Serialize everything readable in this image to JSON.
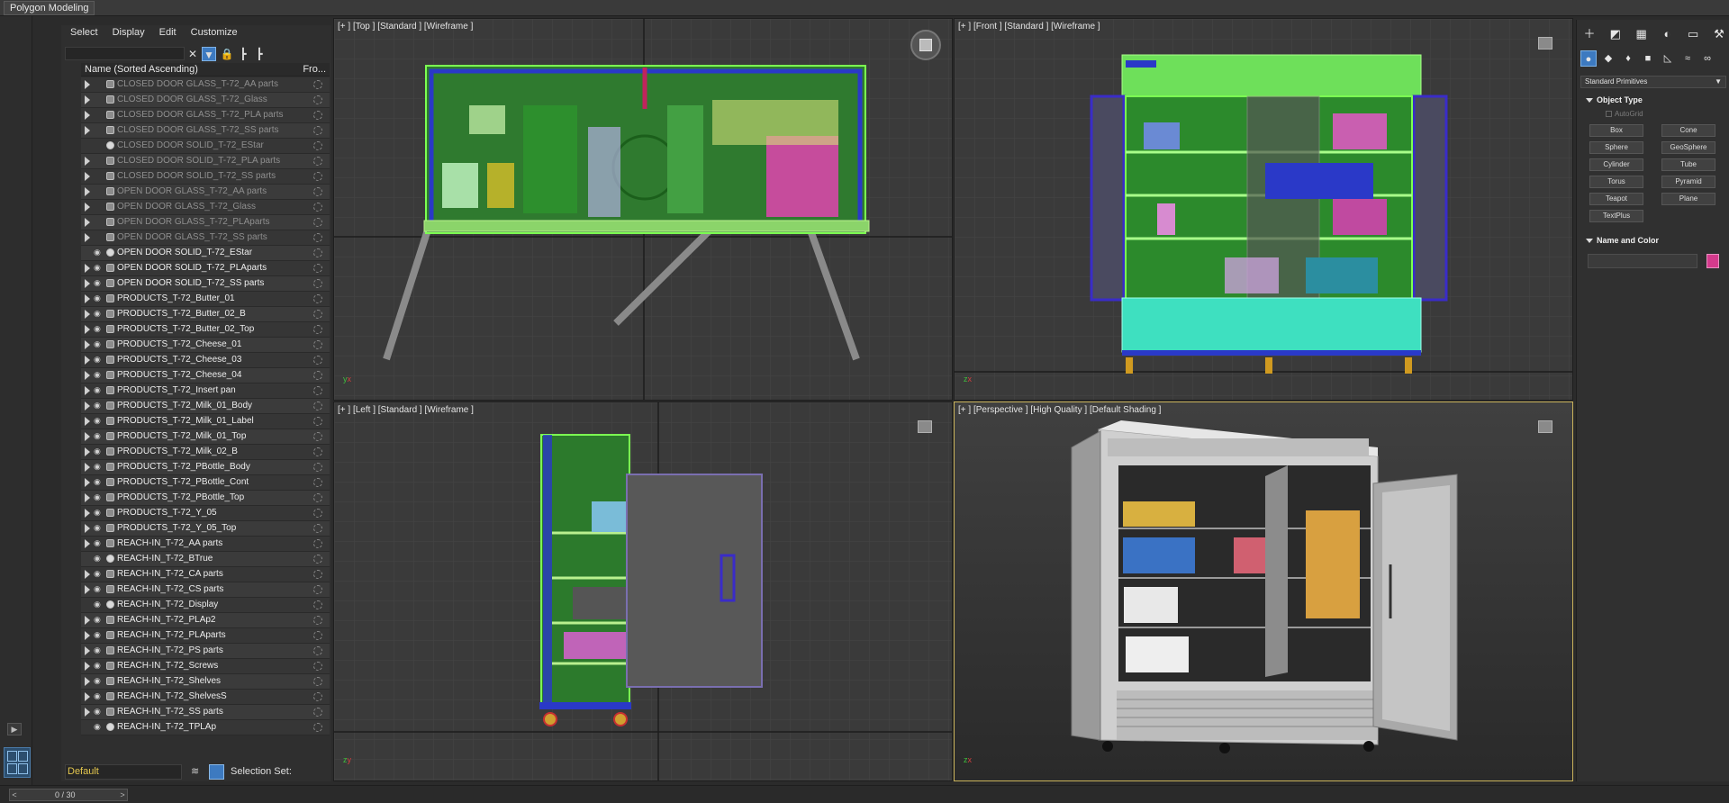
{
  "window": {
    "tab_title": "Polygon Modeling"
  },
  "explorer": {
    "menu": [
      "Select",
      "Display",
      "Edit",
      "Customize"
    ],
    "column_name": "Name (Sorted Ascending)",
    "column_frozen": "Fro...",
    "rows": [
      {
        "name": "CLOSED DOOR GLASS_T-72_AA parts",
        "frozen": true,
        "expand": true,
        "kind": "group"
      },
      {
        "name": "CLOSED DOOR GLASS_T-72_Glass",
        "frozen": true,
        "expand": true,
        "kind": "group"
      },
      {
        "name": "CLOSED DOOR GLASS_T-72_PLA parts",
        "frozen": true,
        "expand": true,
        "kind": "group"
      },
      {
        "name": "CLOSED DOOR GLASS_T-72_SS parts",
        "frozen": true,
        "expand": true,
        "kind": "group"
      },
      {
        "name": "CLOSED DOOR SOLID_T-72_EStar",
        "frozen": true,
        "expand": false,
        "kind": "object"
      },
      {
        "name": "CLOSED DOOR SOLID_T-72_PLA parts",
        "frozen": true,
        "expand": true,
        "kind": "group"
      },
      {
        "name": "CLOSED DOOR SOLID_T-72_SS parts",
        "frozen": true,
        "expand": true,
        "kind": "group"
      },
      {
        "name": "OPEN DOOR GLASS_T-72_AA parts",
        "frozen": true,
        "expand": true,
        "kind": "group"
      },
      {
        "name": "OPEN DOOR GLASS_T-72_Glass",
        "frozen": true,
        "expand": true,
        "kind": "group"
      },
      {
        "name": "OPEN DOOR GLASS_T-72_PLAparts",
        "frozen": true,
        "expand": true,
        "kind": "group"
      },
      {
        "name": "OPEN DOOR GLASS_T-72_SS parts",
        "frozen": true,
        "expand": true,
        "kind": "group"
      },
      {
        "name": "OPEN DOOR SOLID_T-72_EStar",
        "frozen": false,
        "expand": false,
        "kind": "object"
      },
      {
        "name": "OPEN DOOR SOLID_T-72_PLAparts",
        "frozen": false,
        "expand": true,
        "kind": "group"
      },
      {
        "name": "OPEN DOOR SOLID_T-72_SS parts",
        "frozen": false,
        "expand": true,
        "kind": "group"
      },
      {
        "name": "PRODUCTS_T-72_Butter_01",
        "frozen": false,
        "expand": true,
        "kind": "group"
      },
      {
        "name": "PRODUCTS_T-72_Butter_02_B",
        "frozen": false,
        "expand": true,
        "kind": "group"
      },
      {
        "name": "PRODUCTS_T-72_Butter_02_Top",
        "frozen": false,
        "expand": true,
        "kind": "group"
      },
      {
        "name": "PRODUCTS_T-72_Cheese_01",
        "frozen": false,
        "expand": true,
        "kind": "group"
      },
      {
        "name": "PRODUCTS_T-72_Cheese_03",
        "frozen": false,
        "expand": true,
        "kind": "group"
      },
      {
        "name": "PRODUCTS_T-72_Cheese_04",
        "frozen": false,
        "expand": true,
        "kind": "group"
      },
      {
        "name": "PRODUCTS_T-72_Insert pan",
        "frozen": false,
        "expand": true,
        "kind": "group"
      },
      {
        "name": "PRODUCTS_T-72_Milk_01_Body",
        "frozen": false,
        "expand": true,
        "kind": "group"
      },
      {
        "name": "PRODUCTS_T-72_Milk_01_Label",
        "frozen": false,
        "expand": true,
        "kind": "group"
      },
      {
        "name": "PRODUCTS_T-72_Milk_01_Top",
        "frozen": false,
        "expand": true,
        "kind": "group"
      },
      {
        "name": "PRODUCTS_T-72_Milk_02_B",
        "frozen": false,
        "expand": true,
        "kind": "group"
      },
      {
        "name": "PRODUCTS_T-72_PBottle_Body",
        "frozen": false,
        "expand": true,
        "kind": "group"
      },
      {
        "name": "PRODUCTS_T-72_PBottle_Cont",
        "frozen": false,
        "expand": true,
        "kind": "group"
      },
      {
        "name": "PRODUCTS_T-72_PBottle_Top",
        "frozen": false,
        "expand": true,
        "kind": "group"
      },
      {
        "name": "PRODUCTS_T-72_Y_05",
        "frozen": false,
        "expand": true,
        "kind": "group"
      },
      {
        "name": "PRODUCTS_T-72_Y_05_Top",
        "frozen": false,
        "expand": true,
        "kind": "group"
      },
      {
        "name": "REACH-IN_T-72_AA parts",
        "frozen": false,
        "expand": true,
        "kind": "group"
      },
      {
        "name": "REACH-IN_T-72_BTrue",
        "frozen": false,
        "expand": false,
        "kind": "object"
      },
      {
        "name": "REACH-IN_T-72_CA parts",
        "frozen": false,
        "expand": true,
        "kind": "group"
      },
      {
        "name": "REACH-IN_T-72_CS parts",
        "frozen": false,
        "expand": true,
        "kind": "group"
      },
      {
        "name": "REACH-IN_T-72_Display",
        "frozen": false,
        "expand": false,
        "kind": "object"
      },
      {
        "name": "REACH-IN_T-72_PLAp2",
        "frozen": false,
        "expand": true,
        "kind": "group"
      },
      {
        "name": "REACH-IN_T-72_PLAparts",
        "frozen": false,
        "expand": true,
        "kind": "group"
      },
      {
        "name": "REACH-IN_T-72_PS parts",
        "frozen": false,
        "expand": true,
        "kind": "group"
      },
      {
        "name": "REACH-IN_T-72_Screws",
        "frozen": false,
        "expand": true,
        "kind": "group"
      },
      {
        "name": "REACH-IN_T-72_Shelves",
        "frozen": false,
        "expand": true,
        "kind": "group"
      },
      {
        "name": "REACH-IN_T-72_ShelvesS",
        "frozen": false,
        "expand": true,
        "kind": "group"
      },
      {
        "name": "REACH-IN_T-72_SS parts",
        "frozen": false,
        "expand": true,
        "kind": "group"
      },
      {
        "name": "REACH-IN_T-72_TPLAp",
        "frozen": false,
        "expand": false,
        "kind": "object"
      }
    ],
    "layer_name": "Default",
    "selection_set_label": "Selection Set:"
  },
  "viewports": {
    "top": {
      "plus": "[+ ]",
      "view": "[Top ]",
      "quality": "[Standard ]",
      "shading": "[Wireframe ]"
    },
    "front": {
      "plus": "[+ ]",
      "view": "[Front ]",
      "quality": "[Standard ]",
      "shading": "[Wireframe ]"
    },
    "left": {
      "plus": "[+ ]",
      "view": "[Left ]",
      "quality": "[Standard ]",
      "shading": "[Wireframe ]"
    },
    "perspective": {
      "plus": "[+ ]",
      "view": "[Perspective ]",
      "quality": "[High Quality ]",
      "shading": "[Default Shading ]"
    }
  },
  "command_panel": {
    "dropdown": "Standard Primitives",
    "object_type_title": "Object Type",
    "autogrid": "AutoGrid",
    "buttons": [
      "Box",
      "Cone",
      "Sphere",
      "GeoSphere",
      "Cylinder",
      "Tube",
      "Torus",
      "Pyramid",
      "Teapot",
      "Plane",
      "TextPlus"
    ],
    "name_color_title": "Name and Color",
    "swatch_color": "#d43a8c"
  },
  "timeline": {
    "frame": "0 / 30"
  },
  "colors": {
    "active_viewport": "#c9b25a",
    "layer_text": "#e3c64e",
    "accent": "#3d7ac0"
  }
}
